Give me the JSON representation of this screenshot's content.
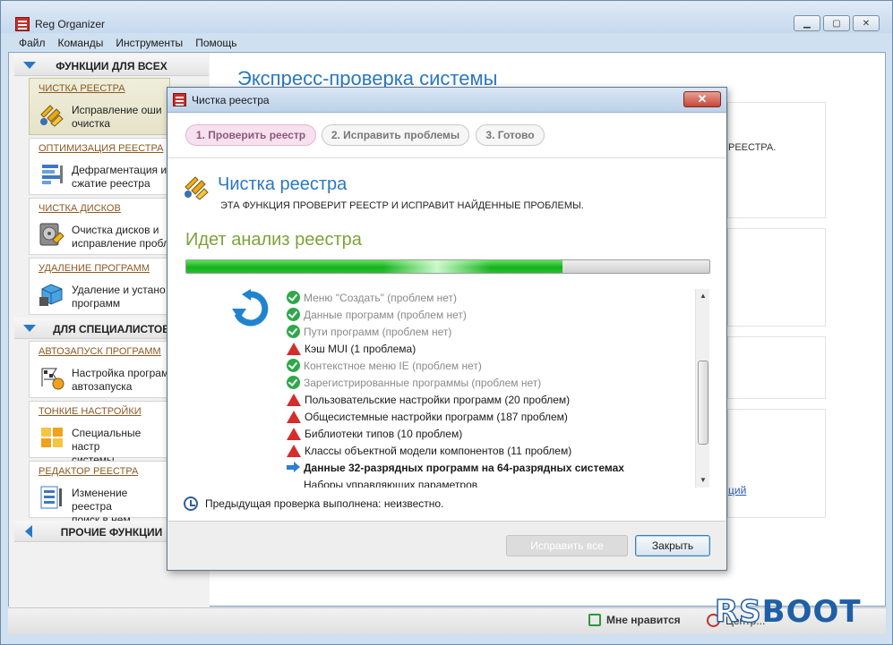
{
  "app": {
    "title": "Reg Organizer"
  },
  "menu": [
    "Файл",
    "Команды",
    "Инструменты",
    "Помощь"
  ],
  "sections": {
    "all": "ФУНКЦИИ ДЛЯ ВСЕХ",
    "specialists": "ДЛЯ СПЕЦИАЛИСТОВ",
    "other": "ПРОЧИЕ ФУНКЦИИ"
  },
  "nav_cards": [
    {
      "title": "ЧИСТКА РЕЕСТРА",
      "text": "Исправление оши\nочистка",
      "icon": "registry-clean-icon"
    },
    {
      "title": "ОПТИМИЗАЦИЯ РЕЕСТРА",
      "text": "Дефрагментация и\nсжатие реестра",
      "icon": "registry-optimize-icon"
    },
    {
      "title": "ЧИСТКА ДИСКОВ",
      "text": "Очистка дисков и\nисправление пробл",
      "icon": "disk-clean-icon"
    },
    {
      "title": "УДАЛЕНИЕ ПРОГРАММ",
      "text": "Удаление и устано\nпрограмм",
      "icon": "uninstall-icon"
    },
    {
      "title": "АВТОЗАПУСК ПРОГРАММ",
      "text": "Настройка програм\nавтозапуска",
      "icon": "autorun-icon"
    },
    {
      "title": "ТОНКИЕ НАСТРОЙКИ",
      "text": "Специальные настр\nсистемы",
      "icon": "tweaks-icon"
    },
    {
      "title": "РЕДАКТОР РЕЕСТРА",
      "text": "Изменение реестра\nпоиск в нем",
      "icon": "registry-editor-icon"
    }
  ],
  "main": {
    "title": "Экспресс-проверка системы",
    "card_text": "РЕЕСТРА.",
    "card_link": "ций"
  },
  "status": {
    "like": "Мне нравится",
    "center": "Центр..."
  },
  "watermark": {
    "rs": "RS",
    "boot": "BOOT"
  },
  "dialog": {
    "title": "Чистка реестра",
    "close": "✕",
    "steps": [
      "1. Проверить реестр",
      "2. Исправить проблемы",
      "3. Готово"
    ],
    "module_title": "Чистка реестра",
    "module_desc": "ЭТА ФУНКЦИЯ ПРОВЕРИТ РЕЕСТР И ИСПРАВИТ НАЙДЕННЫЕ ПРОБЛЕМЫ.",
    "analysis_title": "Идет анализ реестра",
    "progress": 0.72,
    "log": [
      {
        "text": "Меню \"Создать\" (проблем нет)",
        "status": "ok"
      },
      {
        "text": "Данные программ (проблем нет)",
        "status": "ok"
      },
      {
        "text": "Пути программ (проблем нет)",
        "status": "ok"
      },
      {
        "text": "Кэш MUI (1 проблема)",
        "status": "warn"
      },
      {
        "text": "Контекстное меню IE (проблем нет)",
        "status": "ok"
      },
      {
        "text": "Зарегистрированные программы (проблем нет)",
        "status": "ok"
      },
      {
        "text": "Пользовательские настройки программ (20 проблем)",
        "status": "warn"
      },
      {
        "text": "Общесистемные настройки программ (187 проблем)",
        "status": "warn"
      },
      {
        "text": "Библиотеки типов (10 проблем)",
        "status": "warn"
      },
      {
        "text": "Классы объектной модели компонентов (11 проблем)",
        "status": "warn"
      },
      {
        "text": "Данные 32-разрядных программ на 64-разрядных системах",
        "status": "current"
      },
      {
        "text": "Наборы управляющих параметров",
        "status": "pending"
      }
    ],
    "prev_check": "Предыдущая проверка выполнена: неизвестно.",
    "btn_fix": "Исправить все",
    "btn_close": "Закрыть"
  },
  "colors": {
    "accent": "#2a78c4",
    "ok": "#2ea84a",
    "warn": "#d52c2c",
    "analysis": "#7da23a"
  }
}
